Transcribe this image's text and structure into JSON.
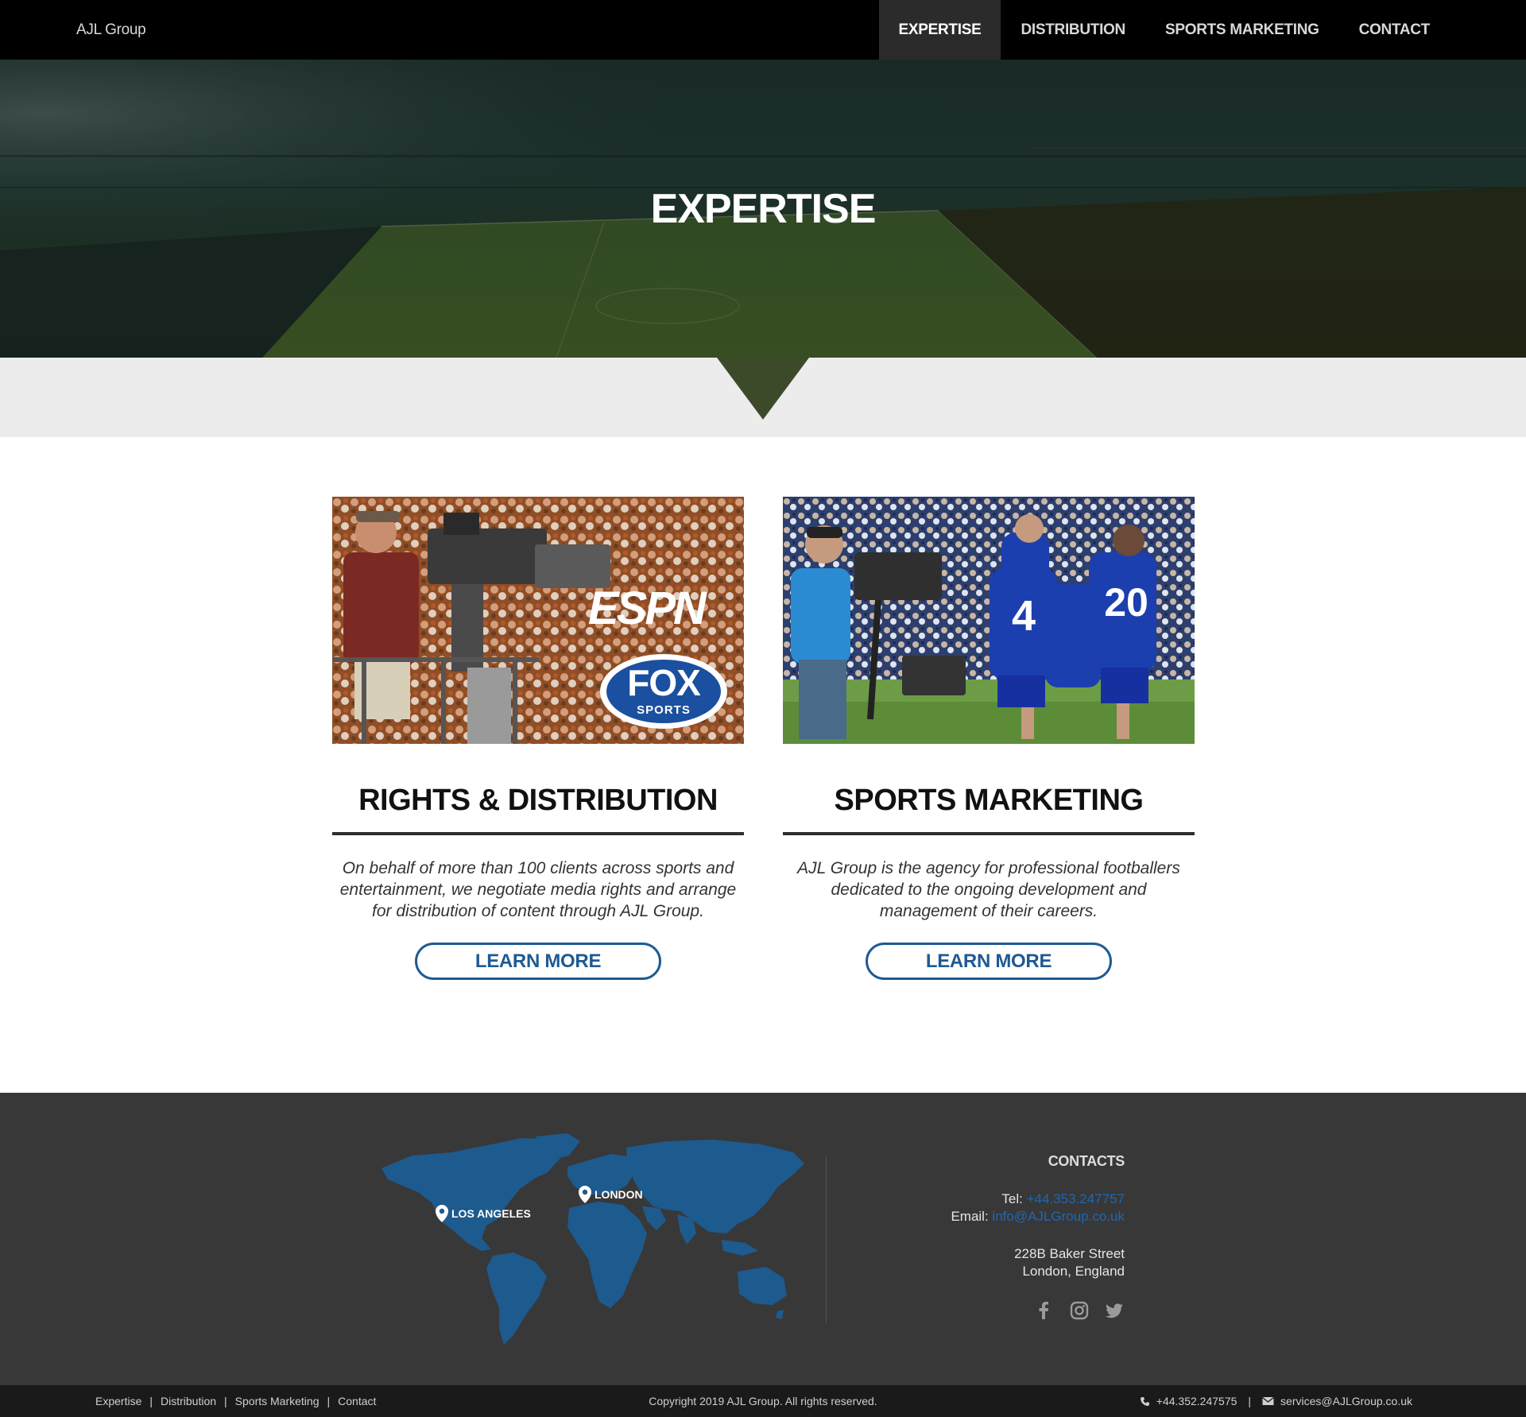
{
  "nav": {
    "brand": "AJL Group",
    "items": [
      {
        "label": "EXPERTISE"
      },
      {
        "label": "DISTRIBUTION"
      },
      {
        "label": "SPORTS MARKETING"
      },
      {
        "label": "CONTACT"
      }
    ],
    "active_index": 0
  },
  "hero": {
    "title": "EXPERTISE"
  },
  "cards": [
    {
      "image_alt_brands": [
        "ESPN",
        "FOX",
        "SPORTS"
      ],
      "title": "RIGHTS & DISTRIBUTION",
      "text": "On behalf of more than 100 clients across sports and entertainment, we negotiate media rights and arrange for distribution of content through AJL Group.",
      "button": "LEARN MORE"
    },
    {
      "image_jersey_numbers": [
        "4",
        "20"
      ],
      "title": "SPORTS MARKETING",
      "text": "AJL Group is the agency for professional footballers dedicated to the ongoing development and management of their careers.",
      "button": "LEARN MORE"
    }
  ],
  "footer": {
    "map_labels": [
      "LOS ANGELES",
      "LONDON"
    ],
    "contacts_heading": "CONTACTS",
    "tel_label": "Tel:",
    "tel_value": "+44.353.247757",
    "email_label": "Email:",
    "email_value": "info@AJLGroup.co.uk",
    "address_line1": "228B Baker Street",
    "address_line2": "London, England",
    "social": [
      "facebook-icon",
      "instagram-icon",
      "twitter-icon"
    ]
  },
  "bottom": {
    "links": [
      "Expertise",
      "Distribution",
      "Sports Marketing",
      "Contact"
    ],
    "separator": "|",
    "copyright": "Copyright 2019 AJL Group. All rights reserved.",
    "phone": "+44.352.247575",
    "email": "services@AJLGroup.co.uk"
  },
  "colors": {
    "nav_bg": "#000000",
    "accent_blue": "#1e5a93",
    "map_blue": "#1d5a8e",
    "footer_bg": "#383838",
    "band_bg": "#ececec"
  }
}
